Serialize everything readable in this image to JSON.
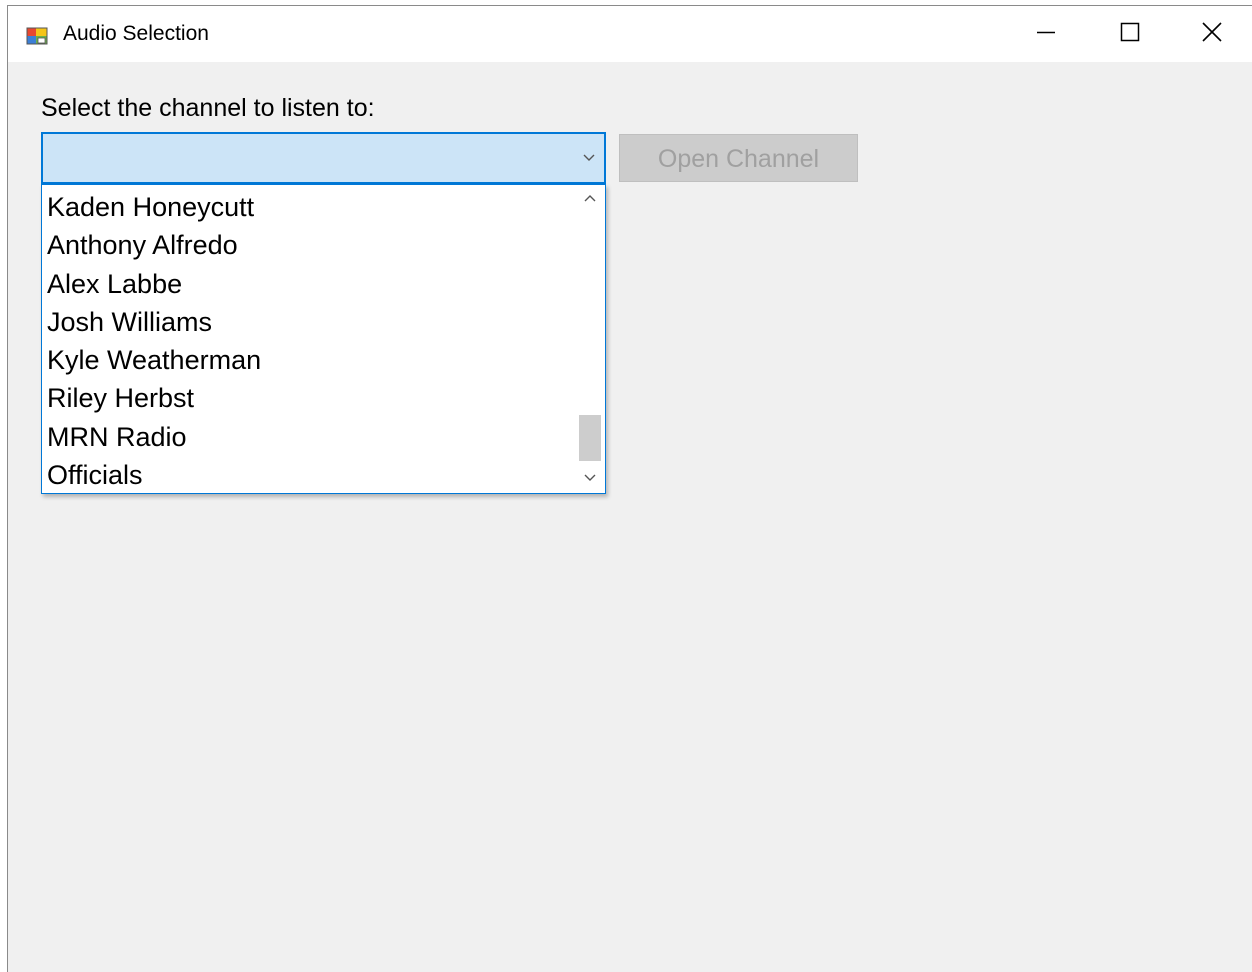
{
  "window": {
    "title": "Audio Selection",
    "app_icon": "winforms-app-icon",
    "controls": {
      "minimize_icon": "minimize-icon",
      "maximize_icon": "maximize-icon",
      "close_icon": "close-icon"
    }
  },
  "form": {
    "prompt": "Select the channel to listen to:",
    "combo": {
      "value": "",
      "arrow_icon": "chevron-down-icon",
      "options": [
        "Kaden Honeycutt",
        "Anthony Alfredo",
        "Alex Labbe",
        "Josh Williams",
        "Kyle Weatherman",
        "Riley Herbst",
        "MRN Radio",
        "Officials"
      ],
      "scroll_position": 0.86
    },
    "open_button_label": "Open Channel"
  },
  "colors": {
    "accent": "#0078d7",
    "combo_focus_bg": "#cce4f7",
    "disabled_button_bg": "#cccccc",
    "disabled_text": "#a0a0a0",
    "window_bg": "#f0f0f0"
  }
}
